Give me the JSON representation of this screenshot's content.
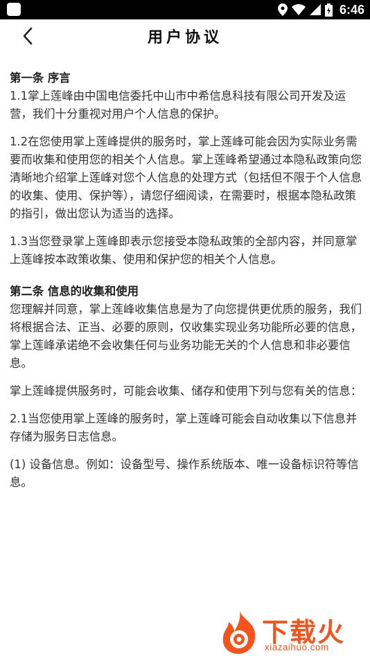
{
  "status_bar": {
    "time": "6:46",
    "icons": [
      "app-icon",
      "location-icon",
      "wifi-icon",
      "signal-icon",
      "battery-icon"
    ]
  },
  "header": {
    "back_icon": "chevron-left-icon",
    "title": "用户协议"
  },
  "content": {
    "section1_heading": "第一条 序言",
    "p1_1": "1.1掌上莲峰由中国电信委托中山市中希信息科技有限公司开发及运营，我们十分重视对用户个人信息的保护。",
    "p1_2": "1.2在您使用掌上莲峰提供的服务时，掌上莲峰可能会因为实际业务需要而收集和使用您的相关个人信息。掌上莲峰希望通过本隐私政策向您清晰地介绍掌上莲峰对您个人信息的处理方式（包括但不限于个人信息的收集、使用、保护等），请您仔细阅读，在需要时，根据本隐私政策的指引，做出您认为适当的选择。",
    "p1_3": "1.3当您登录掌上莲峰即表示您接受本隐私政策的全部内容，并同意掌上莲峰按本政策收集、使用和保护您的相关个人信息。",
    "section2_heading": "第二条 信息的收集和使用",
    "p2_intro": "您理解并同意，掌上莲峰收集信息是为了向您提供更优质的服务，我们将根据合法、正当、必要的原则，仅收集实现业务功能所必要的信息，掌上莲峰承诺绝不会收集任何与业务功能无关的个人信息和非必要信息。",
    "p2_list_intro": "掌上莲峰提供服务时，可能会收集、储存和使用下列与您有关的信息：",
    "p2_1": "2.1当您使用掌上莲峰的服务时，掌上莲峰可能会自动收集以下信息并存储为服务日志信息。",
    "p2_1_1": "(1) 设备信息。例如：设备型号、操作系统版本、唯一设备标识符等信息。"
  },
  "watermark": {
    "brand": "下载火",
    "domain": "xiazaihuo.com"
  },
  "colors": {
    "status_bar_bg": "#000000",
    "watermark_orange": "#f2541b"
  }
}
